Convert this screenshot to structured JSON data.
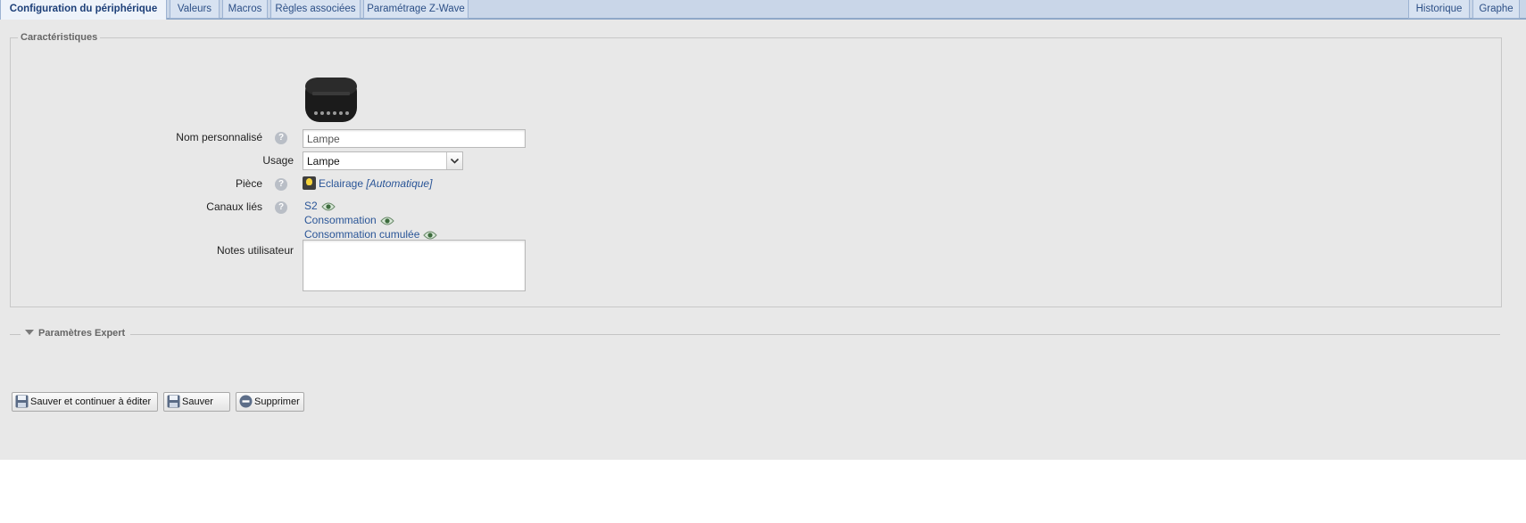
{
  "tabs": [
    {
      "label": "Configuration du périphérique",
      "active": true
    },
    {
      "label": "Valeurs"
    },
    {
      "label": "Macros"
    },
    {
      "label": "Règles associées"
    },
    {
      "label": "Paramétrage Z-Wave"
    },
    {
      "label": "Historique"
    },
    {
      "label": "Graphe"
    }
  ],
  "characteristics": {
    "legend": "Caractéristiques",
    "custom_name": {
      "label": "Nom personnalisé",
      "value": "Lampe"
    },
    "usage": {
      "label": "Usage",
      "selected": "Lampe"
    },
    "room": {
      "label": "Pièce",
      "name": "Eclairage",
      "mode": "[Automatique]"
    },
    "linked_channels": {
      "label": "Canaux liés",
      "items": [
        "S2",
        "Consommation",
        "Consommation cumulée"
      ]
    },
    "notes": {
      "label": "Notes utilisateur",
      "value": ""
    }
  },
  "expert": {
    "label": "Paramètres Expert"
  },
  "buttons": {
    "save_continue": "Sauver et continuer à éditer",
    "save": "Sauver",
    "delete": "Supprimer"
  },
  "colors": {
    "tab_bar": "#c9d6e8",
    "link": "#2a5597",
    "panel": "#e8e8e8"
  }
}
